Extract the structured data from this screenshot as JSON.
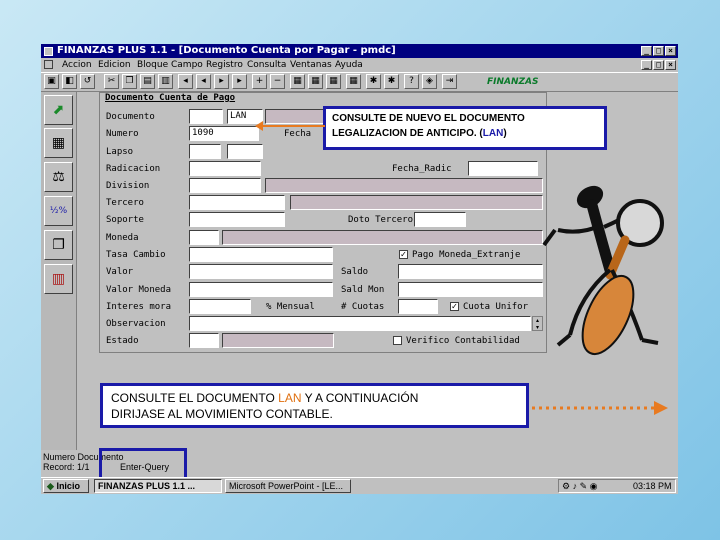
{
  "window": {
    "title": "FINANZAS PLUS 1.1 - [Documento Cuenta por Pagar - pmdc]",
    "controls": [
      "_",
      "□",
      "×"
    ],
    "inner_controls": [
      "_",
      "□",
      "×"
    ]
  },
  "menu": [
    "Accion",
    "Edicion",
    "Bloque",
    "Campo",
    "Registro",
    "Consulta",
    "Ventanas",
    "Ayuda"
  ],
  "toolbar": {
    "icons": [
      "save-icon",
      "exit-icon",
      "undo-icon",
      "cut-icon",
      "copy-icon",
      "paste-icon",
      "print-icon",
      "first-record-icon",
      "previous-record-icon",
      "next-record-icon",
      "last-record-icon",
      "insert-record-icon",
      "delete-record-icon",
      "query-icon",
      "execute-query-icon",
      "cancel-query-icon",
      "filter-icon",
      "search-icon",
      "help-icon",
      "info-icon",
      "exit-door-icon"
    ],
    "logo": "FINANZAS"
  },
  "form": {
    "title": "Documento Cuenta de Pago",
    "labels": {
      "documento": "Documento",
      "numero": "Numero",
      "fecha": "Fecha",
      "lapso": "Lapso",
      "radicacion": "Radicacion",
      "fecha_radic": "Fecha_Radic",
      "division": "Division",
      "tercero": "Tercero",
      "soporte": "Soporte",
      "doto_tercero": "Doto Tercero",
      "moneda": "Moneda",
      "tasa_cambio": "Tasa Cambio",
      "pago_moneda": "Pago Moneda_Extranje",
      "valor": "Valor",
      "saldo": "Saldo",
      "valor_moneda": "Valor Moneda",
      "sald_mon": "Sald Mon",
      "interes_mora": "Interes mora",
      "pct_mensual": "% Mensual",
      "num_cuotas": "# Cuotas",
      "cuota_unifor": "Cuota Unifor",
      "observacion": "Observacion",
      "estado": "Estado",
      "verifico": "Verifico Contabilidad"
    },
    "values": {
      "documento": "LAN",
      "numero": "1090"
    },
    "checks": {
      "pago_moneda": "✓",
      "cuota_unifor": "✓"
    }
  },
  "callouts": {
    "top": [
      "CONSULTE DE NUEVO EL DOCUMENTO",
      "LEGALIZACION DE ANTICIPO. (",
      "LAN",
      ")"
    ],
    "bottom": [
      "CONSULTE EL DOCUMENTO ",
      "LAN",
      " Y A CONTINUACIÓN",
      "DIRIJASE AL MOVIMIENTO CONTABLE."
    ]
  },
  "status": {
    "line1": "Numero Documento",
    "record": "Record: 1/1",
    "mode": "Enter-Query"
  },
  "taskbar": {
    "start": "Inicio",
    "tasks": [
      "FINANZAS PLUS 1.1 ...",
      "Microsoft PowerPoint - [LE..."
    ],
    "time": "03:18 PM"
  },
  "colors": {
    "titlebar": "#000080",
    "callout_border": "#1a1aa8",
    "highlight": "#e07010",
    "arrow_orange": "#e87a20",
    "arrow_blue": "#1a1ad0",
    "readonly_field": "#c6b9c1"
  }
}
